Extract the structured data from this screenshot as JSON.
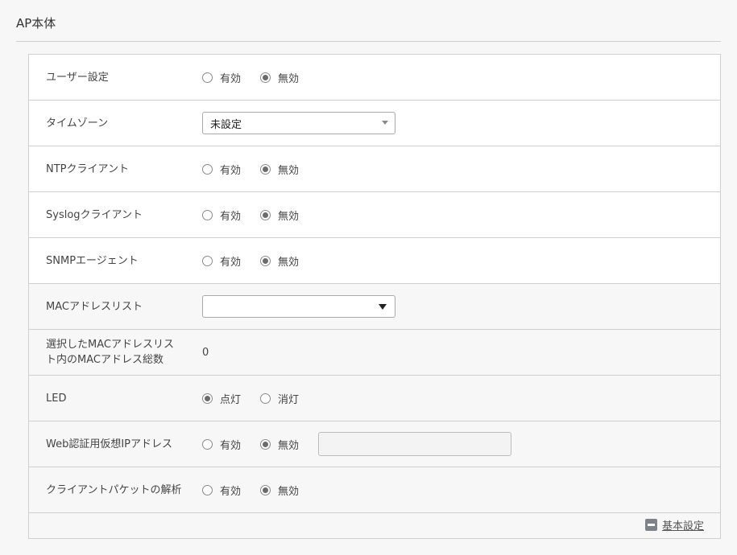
{
  "section": {
    "title": "AP本体"
  },
  "rows": [
    {
      "label": "ユーザー設定",
      "type": "radio",
      "options": [
        "有効",
        "無効"
      ],
      "selected": 1
    },
    {
      "label": "タイムゾーン",
      "type": "select",
      "value": "未設定"
    },
    {
      "label": "NTPクライアント",
      "type": "radio",
      "options": [
        "有効",
        "無効"
      ],
      "selected": 1
    },
    {
      "label": "Syslogクライアント",
      "type": "radio",
      "options": [
        "有効",
        "無効"
      ],
      "selected": 1
    },
    {
      "label": "SNMPエージェント",
      "type": "radio",
      "options": [
        "有効",
        "無効"
      ],
      "selected": 1
    },
    {
      "label": "MACアドレスリスト",
      "type": "select",
      "value": ""
    },
    {
      "label": "選択したMACアドレスリスト内のMACアドレス総数",
      "type": "value",
      "value": "0"
    },
    {
      "label": "LED",
      "type": "radio",
      "options": [
        "点灯",
        "消灯"
      ],
      "selected": 0
    },
    {
      "label": "Web認証用仮想IPアドレス",
      "type": "radio",
      "options": [
        "有効",
        "無効"
      ],
      "selected": 1,
      "input_value": ""
    },
    {
      "label": "クライアントパケットの解析",
      "type": "radio",
      "options": [
        "有効",
        "無効"
      ],
      "selected": 1
    }
  ],
  "footer": {
    "link_label": "基本設定",
    "icon": "minus-square-icon"
  },
  "colors": {
    "border": "#cfcfcf",
    "grey_row": "#f7f7f7",
    "radio_dot": "#6b6b6b"
  }
}
